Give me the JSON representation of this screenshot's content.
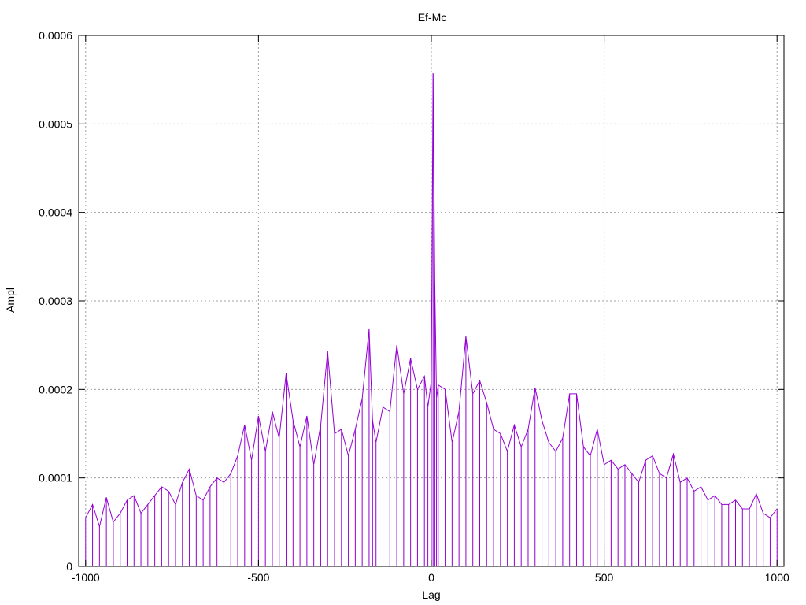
{
  "chart_data": {
    "type": "line",
    "title": "Ef-Mc",
    "xlabel": "Lag",
    "ylabel": "Ampl",
    "xlim": [
      -1020,
      1020
    ],
    "ylim": [
      0,
      0.0006
    ],
    "x_ticks": [
      -1000,
      -500,
      0,
      500,
      1000
    ],
    "x_tick_labels": [
      "-1000",
      "-500",
      "0",
      "500",
      "1000"
    ],
    "y_ticks": [
      0,
      0.0001,
      0.0002,
      0.0003,
      0.0004,
      0.0005,
      0.0006
    ],
    "y_tick_labels": [
      "0",
      "0.0001",
      "0.0002",
      "0.0003",
      "0.0004",
      "0.0005",
      "0.0006"
    ],
    "grid": true,
    "legend": "none",
    "series": [
      {
        "color": "#9400d3",
        "x": [
          -1000,
          -980,
          -960,
          -940,
          -920,
          -900,
          -880,
          -860,
          -840,
          -820,
          -800,
          -780,
          -760,
          -740,
          -720,
          -700,
          -680,
          -660,
          -640,
          -620,
          -600,
          -580,
          -560,
          -540,
          -520,
          -500,
          -480,
          -460,
          -440,
          -420,
          -400,
          -380,
          -360,
          -340,
          -320,
          -300,
          -280,
          -260,
          -240,
          -220,
          -200,
          -180,
          -170,
          -160,
          -140,
          -120,
          -100,
          -80,
          -60,
          -40,
          -20,
          -10,
          0,
          5,
          10,
          15,
          20,
          40,
          60,
          80,
          100,
          120,
          140,
          160,
          180,
          200,
          220,
          240,
          260,
          280,
          300,
          320,
          340,
          360,
          380,
          400,
          420,
          440,
          460,
          480,
          500,
          520,
          540,
          560,
          580,
          600,
          620,
          640,
          660,
          680,
          700,
          720,
          740,
          760,
          780,
          800,
          820,
          840,
          860,
          880,
          900,
          920,
          940,
          960,
          980,
          1000
        ],
        "y": [
          5.5e-05,
          7e-05,
          4.5e-05,
          7.8e-05,
          5e-05,
          6e-05,
          7.5e-05,
          8e-05,
          6e-05,
          7e-05,
          8e-05,
          9e-05,
          8.5e-05,
          7e-05,
          9.5e-05,
          0.00011,
          8e-05,
          7.5e-05,
          9e-05,
          0.0001,
          9.5e-05,
          0.000105,
          0.000125,
          0.00016,
          0.00012,
          0.00017,
          0.00013,
          0.000175,
          0.000145,
          0.000218,
          0.000165,
          0.000135,
          0.00017,
          0.000115,
          0.00016,
          0.000243,
          0.00015,
          0.000155,
          0.000125,
          0.000155,
          0.00019,
          0.000268,
          0.000165,
          0.00014,
          0.00018,
          0.000175,
          0.00025,
          0.000195,
          0.000235,
          0.0002,
          0.000215,
          0.00018,
          0.00021,
          0.000557,
          0.00032,
          0.00019,
          0.000205,
          0.0002,
          0.00014,
          0.000175,
          0.00026,
          0.000195,
          0.00021,
          0.000185,
          0.000155,
          0.00015,
          0.00013,
          0.00016,
          0.000135,
          0.000155,
          0.000202,
          0.000165,
          0.00014,
          0.00013,
          0.000145,
          0.000195,
          0.000195,
          0.000135,
          0.000125,
          0.000155,
          0.000115,
          0.00012,
          0.00011,
          0.000115,
          0.000105,
          9.5e-05,
          0.00012,
          0.000125,
          0.000105,
          0.0001,
          0.000127,
          9.5e-05,
          0.0001,
          8.5e-05,
          9e-05,
          7.5e-05,
          8e-05,
          7e-05,
          7e-05,
          7.5e-05,
          6.5e-05,
          6.5e-05,
          8.2e-05,
          6e-05,
          5.5e-05,
          6.5e-05
        ]
      }
    ]
  }
}
